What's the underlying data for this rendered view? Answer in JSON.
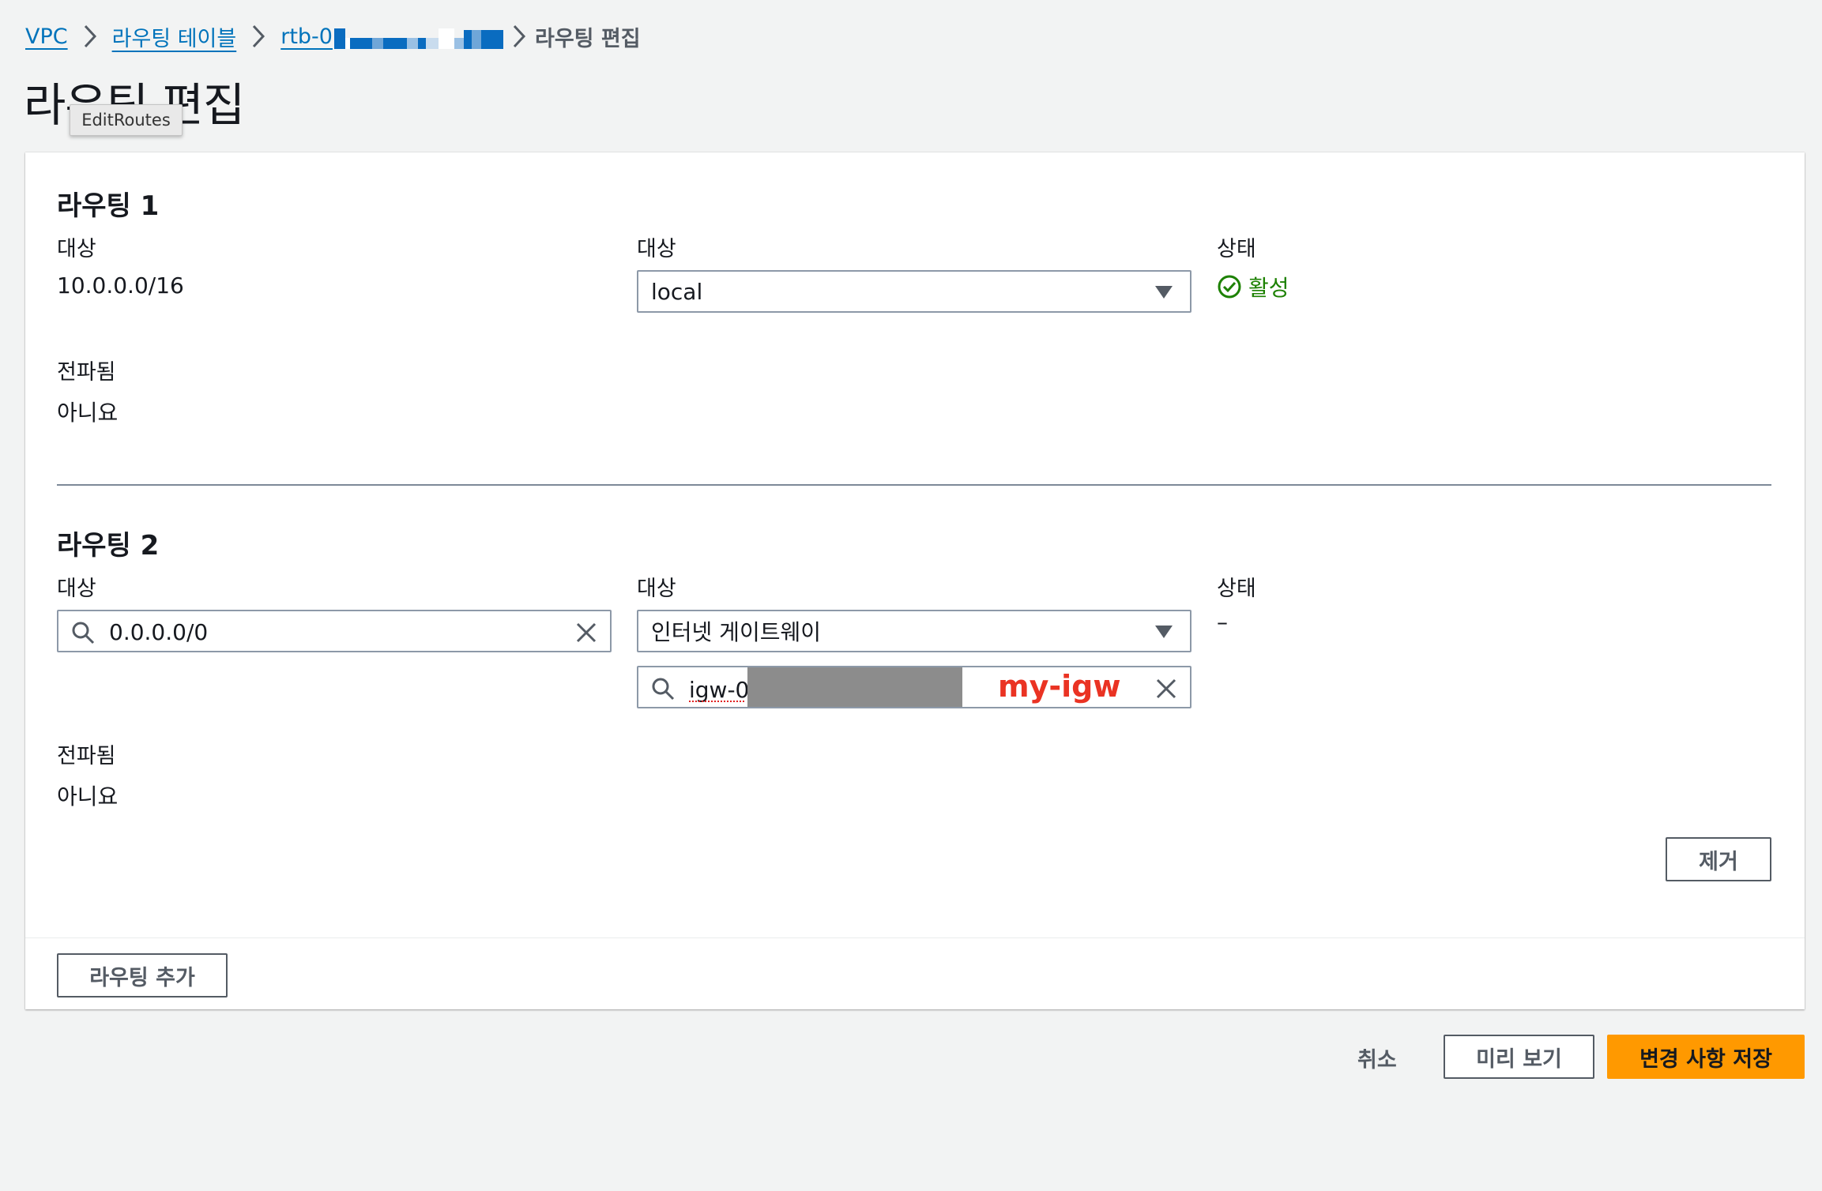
{
  "breadcrumb": {
    "vpc": "VPC",
    "route_tables": "라우팅 테이블",
    "rtb_prefix": "rtb-0",
    "current": "라우팅 편집"
  },
  "page_title": "라우팅 편집",
  "tooltip": "EditRoutes",
  "routes": [
    {
      "title": "라우팅 1",
      "destination_label": "대상",
      "destination_value": "10.0.0.0/16",
      "target_label": "대상",
      "target_value": "local",
      "status_label": "상태",
      "status_value": "활성",
      "propagated_label": "전파됨",
      "propagated_value": "아니요"
    },
    {
      "title": "라우팅 2",
      "destination_label": "대상",
      "destination_value": "0.0.0.0/0",
      "target_label": "대상",
      "target_value": "인터넷 게이트웨이",
      "target_id_value": "igw-0",
      "target_annotation": "my-igw",
      "status_label": "상태",
      "status_value": "–",
      "propagated_label": "전파됨",
      "propagated_value": "아니요",
      "remove_label": "제거"
    }
  ],
  "add_route_label": "라우팅 추가",
  "footer": {
    "cancel_label": "취소",
    "preview_label": "미리 보기",
    "save_label": "변경 사항 저장"
  },
  "colors": {
    "link": "#0073bb",
    "primary": "#ff9900",
    "success": "#1d8102",
    "annotation": "#ea3323"
  }
}
